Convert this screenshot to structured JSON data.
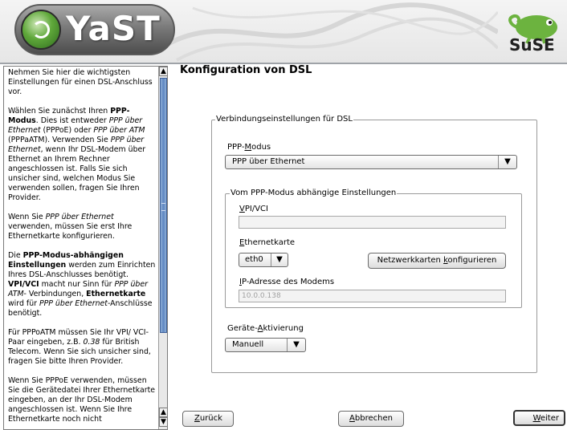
{
  "header": {
    "app_logo_text": "YaST",
    "brand_logo_text": "SuSE"
  },
  "help": {
    "p1": "Nehmen Sie hier die wichtigsten Einstellungen für einen DSL-Anschluss vor.",
    "p2_a": "Wählen Sie zunächst Ihren ",
    "p2_b": "PPP-Modus",
    "p2_c": ". Dies ist entweder ",
    "p2_d": "PPP über Ethernet",
    "p2_e": " (PPPoE) oder ",
    "p2_f": "PPP über ATM",
    "p2_g": " (PPPaATM). Verwenden Sie ",
    "p2_h": "PPP über Ethernet",
    "p2_i": ", wenn Ihr DSL-Modem über Ethernet an Ihrem Rechner angeschlossen ist. Falls Sie sich unsicher sind, welchen Modus Sie verwenden sollen, fragen Sie Ihren Provider.",
    "p3_a": "Wenn Sie ",
    "p3_b": "PPP über Ethernet",
    "p3_c": " verwenden, müssen Sie erst Ihre Ethernetkarte konfigurieren.",
    "p4_a": "Die ",
    "p4_b": "PPP-Modus-abhängigen Einstellungen",
    "p4_c": " werden zum Einrichten Ihres DSL-Anschlusses benötigt. ",
    "p4_d": "VPI/VCI",
    "p4_e": " macht nur Sinn für ",
    "p4_f": "PPP über ATM",
    "p4_g": "- Verbindungen, ",
    "p4_h": "Ethernetkarte",
    "p4_i": " wird für ",
    "p4_j": "PPP über Ethernet",
    "p4_k": "-Anschlüsse benötigt.",
    "p5_a": "Für PPPoATM müssen Sie Ihr VPI/ VCI-Paar eingeben, z.B. ",
    "p5_b": "0.38",
    "p5_c": " für British Telecom. Wenn Sie sich unsicher sind, fragen Sie bitte Ihren Provider.",
    "p6": "Wenn Sie PPPoE verwenden, müssen Sie die Gerätedatei Ihrer Ethernetkarte eingeben, an der Ihr DSL-Modem angeschlossen ist. Wenn Sie Ihre Ethernetkarte noch nicht"
  },
  "main": {
    "title": "Konfiguration von DSL",
    "frame_connection": "Verbindungseinstellungen für DSL",
    "ppp_mode_label_pre": "PPP-",
    "ppp_mode_label_ul": "M",
    "ppp_mode_label_post": "odus",
    "ppp_mode_value": "PPP über Ethernet",
    "frame_dependent": "Vom PPP-Modus abhängige Einstellungen",
    "vpi_label_ul": "V",
    "vpi_label_post": "PI/VCI",
    "vpi_value": "",
    "eth_label_ul": "E",
    "eth_label_post": "thernetkarte",
    "eth_value": "eth0",
    "configure_cards_pre": "Netzwerkkarten ",
    "configure_cards_ul": "k",
    "configure_cards_post": "onfigurieren",
    "ip_label_ul": "I",
    "ip_label_post": "P-Adresse des Modems",
    "ip_value": "10.0.0.138",
    "activation_label_pre": "Geräte-",
    "activation_label_ul": "A",
    "activation_label_post": "ktivierung",
    "activation_value": "Manuell"
  },
  "footer": {
    "back_ul": "Z",
    "back_post": "urück",
    "abort_ul": "A",
    "abort_post": "bbrechen",
    "next_ul": "W",
    "next_post": "eiter"
  },
  "icons": {
    "combo_arrow": "combo-arrow-icon",
    "scroll_up": "scroll-up-icon",
    "scroll_down": "scroll-down-icon"
  },
  "colors": {
    "scroll_thumb": "#5f86c1",
    "logo_green": "#5fa83a"
  }
}
